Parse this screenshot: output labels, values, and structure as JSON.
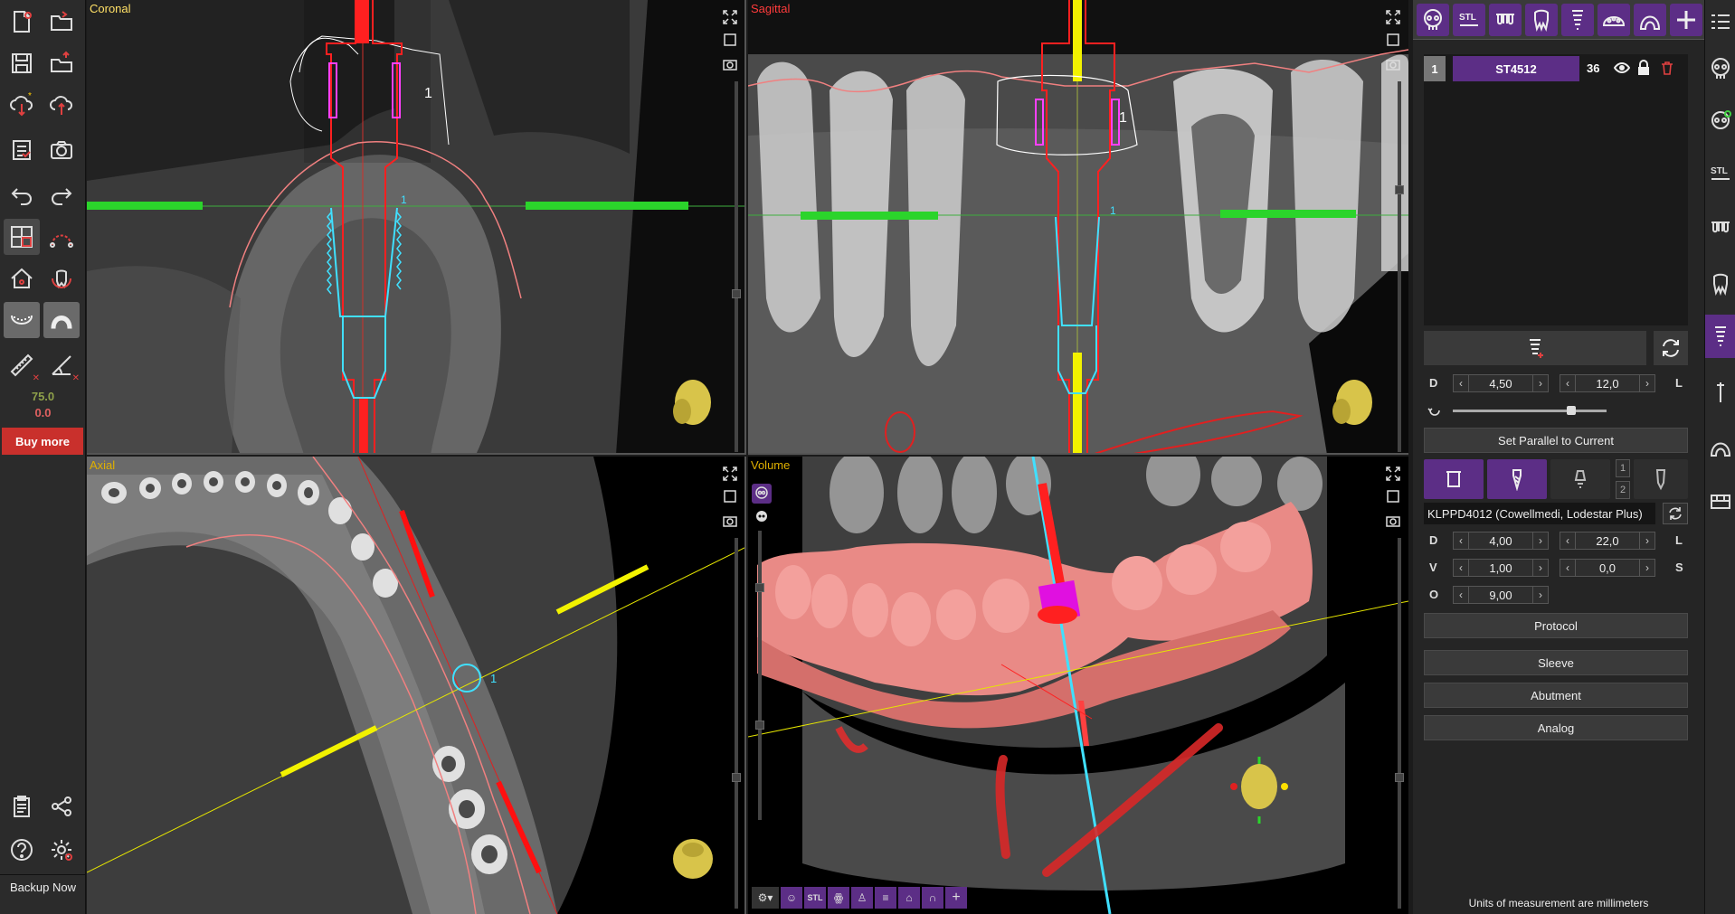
{
  "left_toolbar": {
    "values": {
      "top": "75.0",
      "bottom": "0.0"
    },
    "buy_more": "Buy more",
    "backup_now": "Backup Now"
  },
  "views": {
    "coronal": {
      "title": "Coronal",
      "color": "#ffe066"
    },
    "sagittal": {
      "title": "Sagittal",
      "color": "#ff3b3b"
    },
    "axial": {
      "title": "Axial",
      "color": "#e0b000"
    },
    "volume": {
      "title": "Volume",
      "color": "#e0b000"
    }
  },
  "implant_marker": "1",
  "right_panel": {
    "top_tabs": [
      "skull-icon",
      "stl-icon",
      "dentition-icon",
      "tooth-icon",
      "implant-icon",
      "guide-icon",
      "arch-icon",
      "plus-icon",
      "list-icon"
    ],
    "implant_list": [
      {
        "index": "1",
        "name": "ST4512",
        "count": "36"
      }
    ],
    "geometry": {
      "d_label": "D",
      "l_label": "L",
      "diameter": "4,50",
      "length": "12,0"
    },
    "parallel_button": "Set Parallel to Current",
    "stack_numbers": [
      "1",
      "2"
    ],
    "sleeve_model": "KLPPD4012 (Cowellmedi, Lodestar Plus)",
    "sleeve_fields": {
      "d_label": "D",
      "l_label": "L",
      "v_label": "V",
      "s_label": "S",
      "o_label": "O",
      "d": "4,00",
      "l": "22,0",
      "v": "1,00",
      "s": "0,0",
      "o": "9,00"
    },
    "buttons": [
      "Protocol",
      "Sleeve",
      "Abutment",
      "Analog"
    ],
    "units_note": "Units of measurement are millimeters",
    "accent": "#5c2e86"
  }
}
